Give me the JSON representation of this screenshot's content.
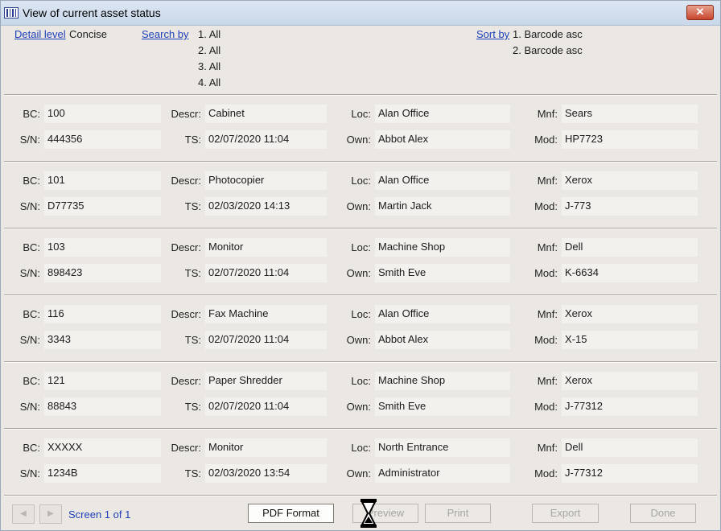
{
  "window": {
    "title": "View of current asset status",
    "close_label": "✕"
  },
  "header": {
    "detail_level_link": "Detail level",
    "detail_level_value": "Concise",
    "search_by_link": "Search by",
    "search_by": [
      "1. All",
      "2. All",
      "3. All",
      "4. All"
    ],
    "sort_by_link": "Sort by",
    "sort_by": [
      "1. Barcode asc",
      "2. Barcode asc"
    ]
  },
  "labels": {
    "bc": "BC:",
    "descr": "Descr:",
    "loc": "Loc:",
    "mnf": "Mnf:",
    "sn": "S/N:",
    "ts": "TS:",
    "own": "Own:",
    "mod": "Mod:"
  },
  "assets": [
    {
      "bc": "100",
      "descr": "Cabinet",
      "loc": "Alan Office",
      "mnf": "Sears",
      "sn": "444356",
      "ts": "02/07/2020 11:04",
      "own": "Abbot Alex",
      "mod": "HP7723"
    },
    {
      "bc": "101",
      "descr": "Photocopier",
      "loc": "Alan Office",
      "mnf": "Xerox",
      "sn": "D77735",
      "ts": "02/03/2020 14:13",
      "own": "Martin Jack",
      "mod": "J-773"
    },
    {
      "bc": "103",
      "descr": "Monitor",
      "loc": "Machine Shop",
      "mnf": "Dell",
      "sn": "898423",
      "ts": "02/07/2020 11:04",
      "own": "Smith Eve",
      "mod": "K-6634"
    },
    {
      "bc": "116",
      "descr": "Fax Machine",
      "loc": "Alan Office",
      "mnf": "Xerox",
      "sn": "3343",
      "ts": "02/07/2020 11:04",
      "own": "Abbot Alex",
      "mod": "X-15"
    },
    {
      "bc": "121",
      "descr": "Paper Shredder",
      "loc": "Machine Shop",
      "mnf": "Xerox",
      "sn": "88843",
      "ts": "02/07/2020 11:04",
      "own": "Smith Eve",
      "mod": "J-77312"
    },
    {
      "bc": "XXXXX",
      "descr": "Monitor",
      "loc": "North Entrance",
      "mnf": "Dell",
      "sn": "1234B",
      "ts": "02/03/2020 13:54",
      "own": "Administrator",
      "mod": "J-77312"
    }
  ],
  "footer": {
    "prev_label": "◀",
    "next_label": "▶",
    "screen_label": "Screen 1 of 1",
    "pdf_label": "PDF Format",
    "preview_label": "Preview",
    "print_label": "Print",
    "export_label": "Export",
    "done_label": "Done"
  }
}
